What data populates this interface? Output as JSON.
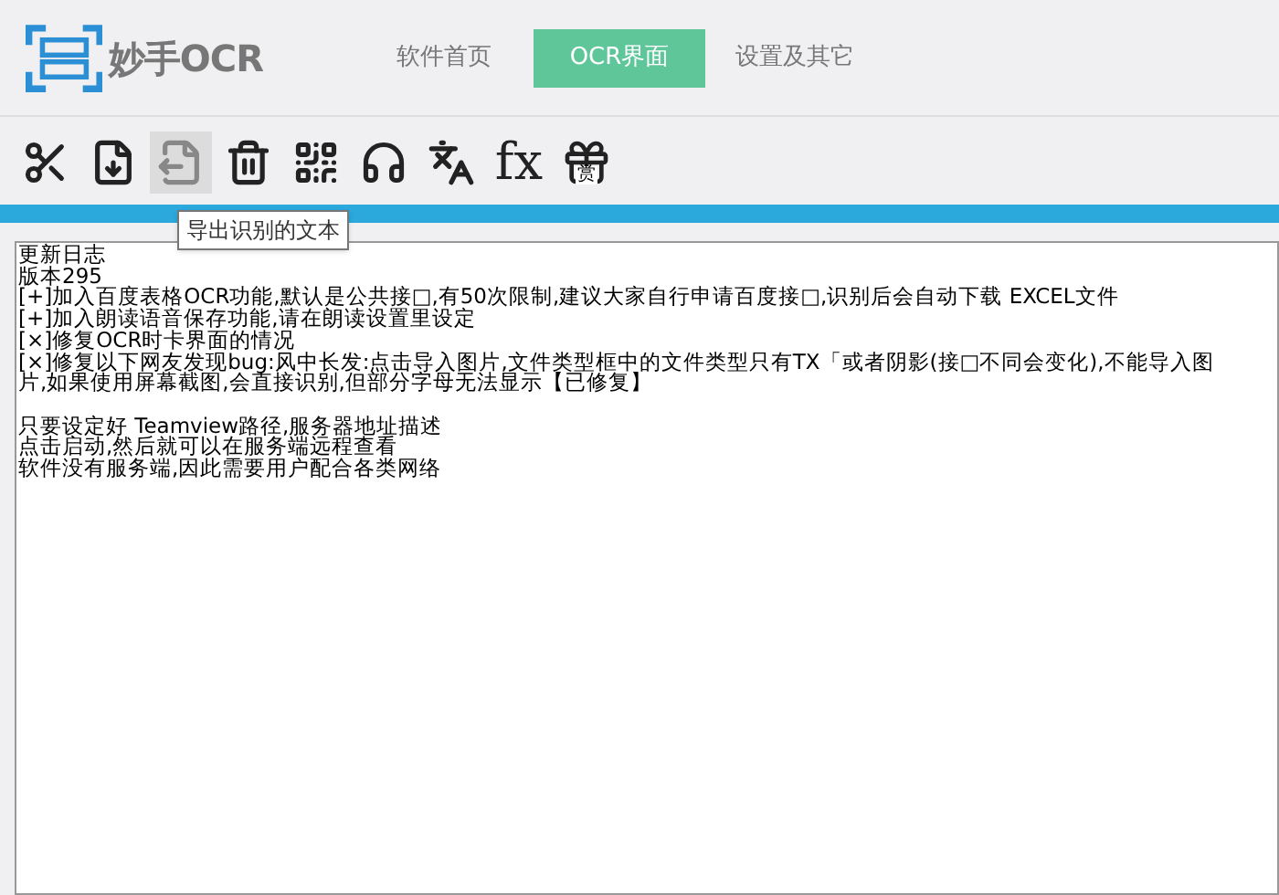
{
  "app": {
    "logo_text": "妙手OCR"
  },
  "nav": [
    {
      "label": "软件首页",
      "selected": false
    },
    {
      "label": "OCR界面",
      "selected": true
    },
    {
      "label": "设置及其它",
      "selected": false
    }
  ],
  "toolbar": [
    {
      "kind": "scissors",
      "hovered": false
    },
    {
      "kind": "import",
      "hovered": false
    },
    {
      "kind": "export",
      "hovered": true
    },
    {
      "kind": "trash",
      "hovered": false
    },
    {
      "kind": "qr",
      "hovered": false
    },
    {
      "kind": "headphones",
      "hovered": false
    },
    {
      "kind": "translate",
      "hovered": false
    },
    {
      "kind": "formula",
      "text": "fx",
      "hovered": false
    },
    {
      "kind": "gift",
      "text": "赏",
      "hovered": false
    }
  ],
  "tooltip": "导出识别的文本",
  "text_blocks": [
    [
      "更新日志",
      "版本295",
      "[+]加入百度表格OCR功能,默认是公共接□,有50次限制,建议大家自行申请百度接□,识别后会自动下载 EXCEL文件",
      "[+]加入朗读语音保存功能,请在朗读设置里设定",
      "[×]修复OCR时卡界面的情况",
      "[×]修复以下网友发现bug:风中长发:点击导入图片,文件类型框中的文件类型只有TX「或者阴影(接□不同会变化),不能导入图",
      "片,如果使用屏幕截图,会直接识别,但部分字母无法显示【已修复】"
    ],
    [
      "只要设定好 Teamview路径,服务器地址描述",
      "点击启动,然后就可以在服务端远程查看",
      "软件没有服务端,因此需要用户配合各类网络"
    ]
  ]
}
